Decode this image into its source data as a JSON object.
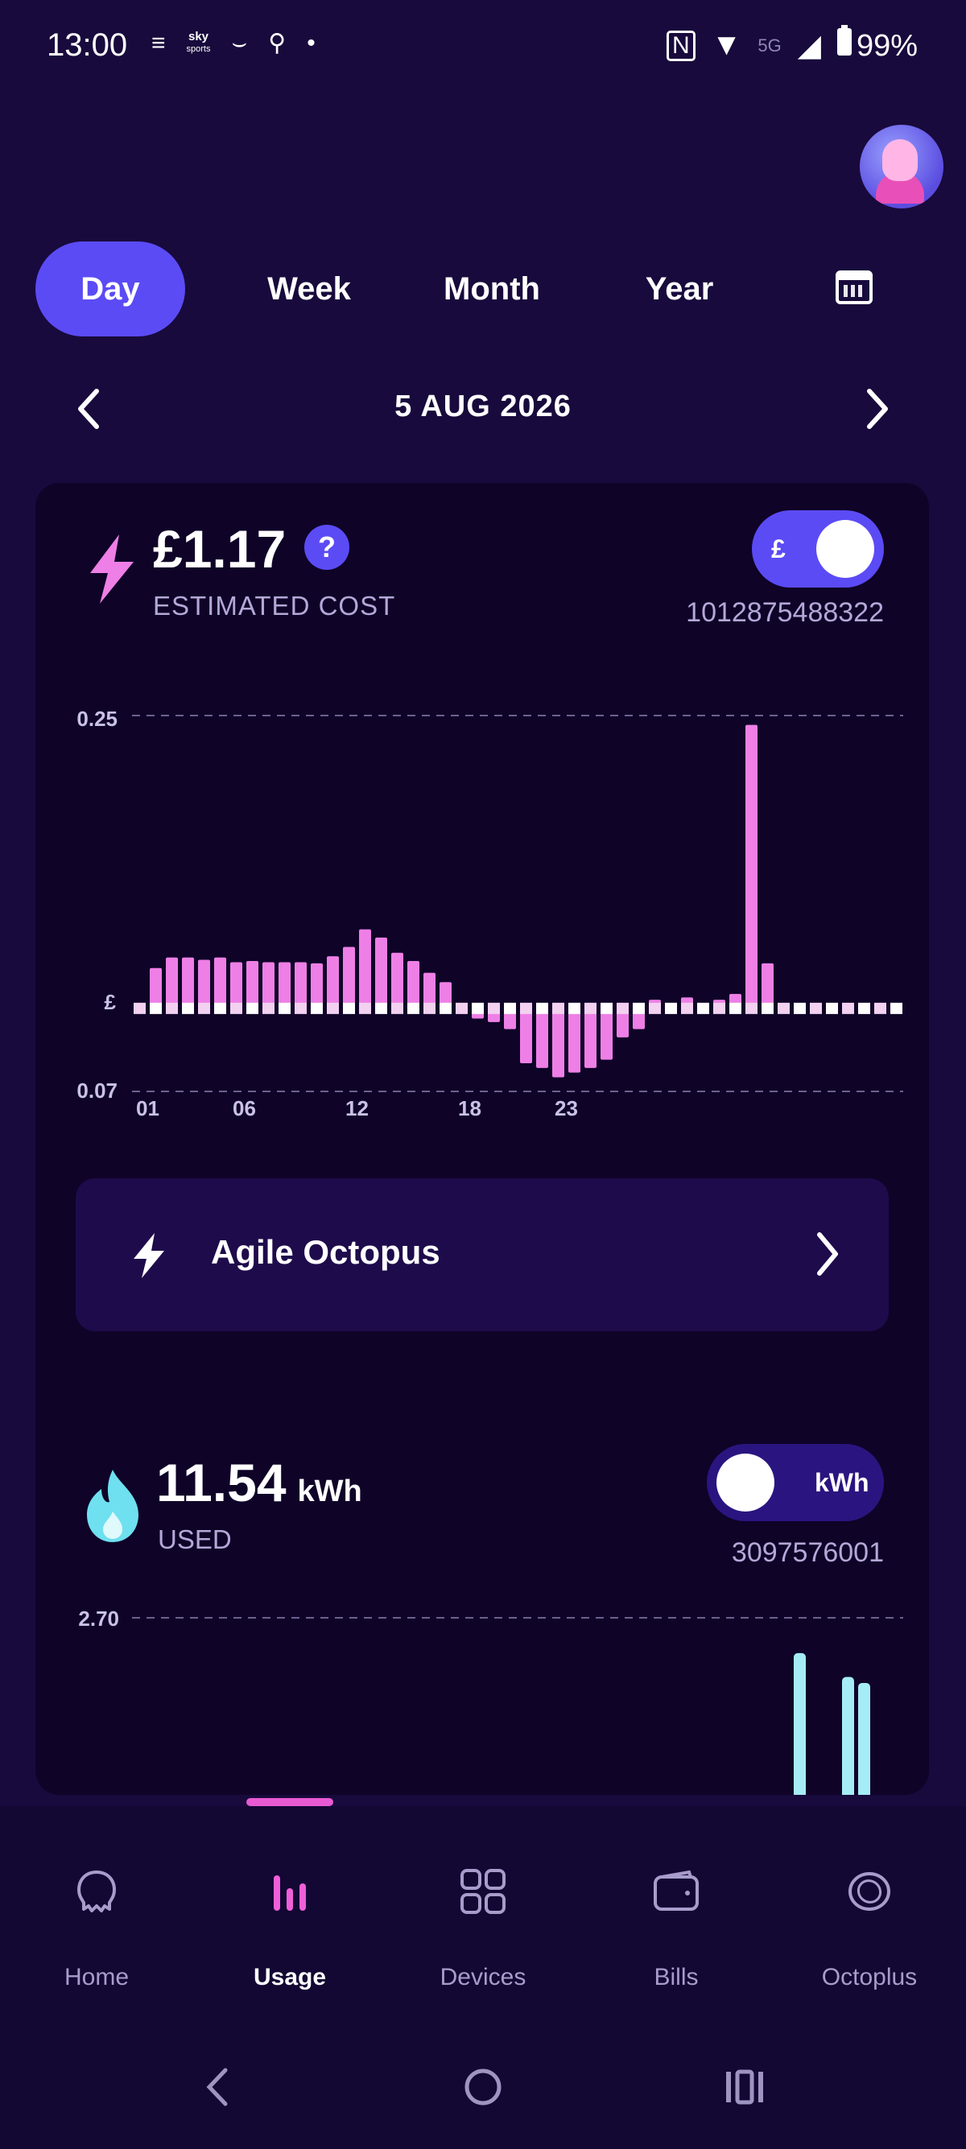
{
  "status_bar": {
    "time": "13:00",
    "sky_line1": "sky",
    "sky_line2": "sports",
    "battery": "99%",
    "network": "5G"
  },
  "tabs": [
    {
      "label": "Day",
      "active": true
    },
    {
      "label": "Week",
      "active": false
    },
    {
      "label": "Month",
      "active": false
    },
    {
      "label": "Year",
      "active": false
    }
  ],
  "date_nav": {
    "date": "5 AUG 2026"
  },
  "electricity": {
    "cost": "£1.17",
    "help": "?",
    "label": "ESTIMATED COST",
    "toggle_label": "£",
    "meter_number": "1012875488322",
    "accent_color": "#ee7fe6"
  },
  "chart_data": [
    {
      "type": "bar",
      "title": "",
      "ylabel": "£",
      "y_top_label": "0.25",
      "y_bottom_label": "0.07",
      "y_mid_label": "£",
      "ylim": [
        -0.07,
        0.25
      ],
      "x_tick_labels": [
        "01",
        "06",
        "12",
        "18",
        "23"
      ],
      "values": [
        0.001,
        0.035,
        0.044,
        0.044,
        0.042,
        0.044,
        0.04,
        0.041,
        0.04,
        0.04,
        0.04,
        0.039,
        0.045,
        0.053,
        0.068,
        0.061,
        0.048,
        0.041,
        0.031,
        0.023,
        -0.004,
        -0.008,
        -0.011,
        -0.017,
        -0.046,
        -0.05,
        -0.058,
        -0.054,
        -0.05,
        -0.043,
        -0.024,
        -0.017,
        0.008,
        0.004,
        0.01,
        0.004,
        0.008,
        0.013,
        0.242,
        0.039,
        0.005,
        0.005,
        0.005,
        0.005,
        0.005,
        0.005,
        0.005,
        0.005
      ],
      "color": "#ee7fe6"
    },
    {
      "type": "bar",
      "title": "",
      "y_top_label": "2.70",
      "ylim": [
        0,
        2.7
      ],
      "values": [
        0,
        0,
        0,
        0,
        0,
        0,
        0,
        0,
        0,
        0,
        0,
        0,
        0,
        0,
        0,
        0,
        0,
        0,
        0,
        0,
        0,
        0,
        0,
        0,
        0,
        0,
        0,
        0,
        0,
        0,
        0,
        0,
        0,
        0,
        0,
        0,
        0,
        0,
        0,
        0,
        0,
        2.62,
        0,
        0,
        2.22,
        2.12,
        0,
        0
      ],
      "color": "#a6ecf7"
    }
  ],
  "tariff": {
    "name": "Agile Octopus"
  },
  "gas": {
    "value": "11.54",
    "unit": "kWh",
    "label": "USED",
    "toggle_label": "kWh",
    "meter_number": "3097576001",
    "accent_color": "#6fe0ef"
  },
  "bottom_nav": [
    {
      "label": "Home",
      "icon": "octopus-icon",
      "active": false
    },
    {
      "label": "Usage",
      "icon": "bar-chart-icon",
      "active": true
    },
    {
      "label": "Devices",
      "icon": "devices-grid-icon",
      "active": false
    },
    {
      "label": "Bills",
      "icon": "wallet-icon",
      "active": false
    },
    {
      "label": "Octoplus",
      "icon": "coin-icon",
      "active": false
    }
  ],
  "colors": {
    "background": "#180a3c",
    "card": "#0f0328",
    "primary": "#5b4bf5",
    "electric": "#ee7fe6",
    "gas": "#a6ecf7"
  }
}
